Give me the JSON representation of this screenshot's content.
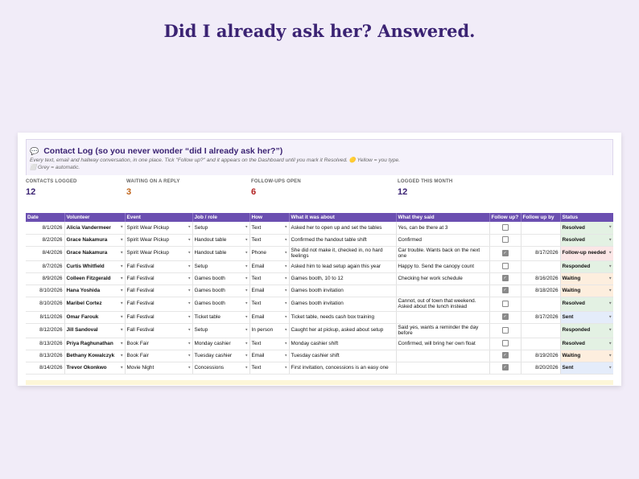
{
  "headline": "Did I already ask her? Answered.",
  "sheet": {
    "title_icon": "💬",
    "title": "Contact Log  (so you never wonder “did I already ask her?”)",
    "subtitle": "Every text, email and hallway conversation, in one place. Tick \"Follow up?\" and it appears on the Dashboard until you mark it Resolved. 🟡 Yellow = you type. ⬜ Grey = automatic."
  },
  "stats": [
    {
      "label": "CONTACTS LOGGED",
      "value": "12",
      "color": "#3b2373"
    },
    {
      "label": "WAITING ON A REPLY",
      "value": "3",
      "color": "#c0641a"
    },
    {
      "label": "FOLLOW-UPS OPEN",
      "value": "6",
      "color": "#b22222"
    },
    {
      "label": "LOGGED THIS MONTH",
      "value": "12",
      "color": "#3b2373"
    }
  ],
  "columns": [
    "Date",
    "Volunteer",
    "Event",
    "Job / role",
    "How",
    "What it was about",
    "What they said",
    "Follow up?",
    "Follow up by",
    "Status"
  ],
  "rows": [
    {
      "date": "8/1/2026",
      "volunteer": "Alicia Vandermeer",
      "event": "Spirit Wear Pickup",
      "job": "Setup",
      "how": "Text",
      "about": "Asked her to open up and set the tables",
      "said": "Yes, can be there at 3",
      "follow": false,
      "by": "",
      "status": "Resolved",
      "cls": "s-resolved"
    },
    {
      "date": "8/2/2026",
      "volunteer": "Grace Nakamura",
      "event": "Spirit Wear Pickup",
      "job": "Handout table",
      "how": "Text",
      "about": "Confirmed the handout table shift",
      "said": "Confirmed",
      "follow": false,
      "by": "",
      "status": "Resolved",
      "cls": "s-resolved"
    },
    {
      "date": "8/4/2026",
      "volunteer": "Grace Nakamura",
      "event": "Spirit Wear Pickup",
      "job": "Handout table",
      "how": "Phone",
      "about": "She did not make it, checked in, no hard feelings",
      "said": "Car trouble. Wants back on the next one",
      "follow": true,
      "by": "8/17/2026",
      "status": "Follow-up needed",
      "cls": "s-followup"
    },
    {
      "date": "8/7/2026",
      "volunteer": "Curtis Whitfield",
      "event": "Fall Festival",
      "job": "Setup",
      "how": "Email",
      "about": "Asked him to lead setup again this year",
      "said": "Happy to. Send the canopy count",
      "follow": false,
      "by": "",
      "status": "Responded",
      "cls": "s-responded"
    },
    {
      "date": "8/9/2026",
      "volunteer": "Colleen Fitzgerald",
      "event": "Fall Festival",
      "job": "Games booth",
      "how": "Text",
      "about": "Games booth, 10 to 12",
      "said": "Checking her work schedule",
      "follow": true,
      "by": "8/16/2026",
      "status": "Waiting",
      "cls": "s-waiting"
    },
    {
      "date": "8/10/2026",
      "volunteer": "Hana Yoshida",
      "event": "Fall Festival",
      "job": "Games booth",
      "how": "Email",
      "about": "Games booth invitation",
      "said": "",
      "follow": true,
      "by": "8/18/2026",
      "status": "Waiting",
      "cls": "s-waiting"
    },
    {
      "date": "8/10/2026",
      "volunteer": "Maribel Cortez",
      "event": "Fall Festival",
      "job": "Games booth",
      "how": "Text",
      "about": "Games booth invitation",
      "said": "Cannot, out of town that weekend. Asked about the lunch instead",
      "follow": false,
      "by": "",
      "status": "Resolved",
      "cls": "s-resolved"
    },
    {
      "date": "8/11/2026",
      "volunteer": "Omar Farouk",
      "event": "Fall Festival",
      "job": "Ticket table",
      "how": "Email",
      "about": "Ticket table, needs cash box training",
      "said": "",
      "follow": true,
      "by": "8/17/2026",
      "status": "Sent",
      "cls": "s-sent"
    },
    {
      "date": "8/12/2026",
      "volunteer": "Jill Sandoval",
      "event": "Fall Festival",
      "job": "Setup",
      "how": "In person",
      "about": "Caught her at pickup, asked about setup",
      "said": "Said yes, wants a reminder the day before",
      "follow": false,
      "by": "",
      "status": "Responded",
      "cls": "s-responded"
    },
    {
      "date": "8/13/2026",
      "volunteer": "Priya Raghunathan",
      "event": "Book Fair",
      "job": "Monday cashier",
      "how": "Text",
      "about": "Monday cashier shift",
      "said": "Confirmed, will bring her own float",
      "follow": false,
      "by": "",
      "status": "Resolved",
      "cls": "s-resolved"
    },
    {
      "date": "8/13/2026",
      "volunteer": "Bethany Kowalczyk",
      "event": "Book Fair",
      "job": "Tuesday cashier",
      "how": "Email",
      "about": "Tuesday cashier shift",
      "said": "",
      "follow": true,
      "by": "8/19/2026",
      "status": "Waiting",
      "cls": "s-waiting"
    },
    {
      "date": "8/14/2026",
      "volunteer": "Trevor Okonkwo",
      "event": "Movie Night",
      "job": "Concessions",
      "how": "Text",
      "about": "First invitation, concessions is an easy one",
      "said": "",
      "follow": true,
      "by": "8/20/2026",
      "status": "Sent",
      "cls": "s-sent"
    }
  ]
}
